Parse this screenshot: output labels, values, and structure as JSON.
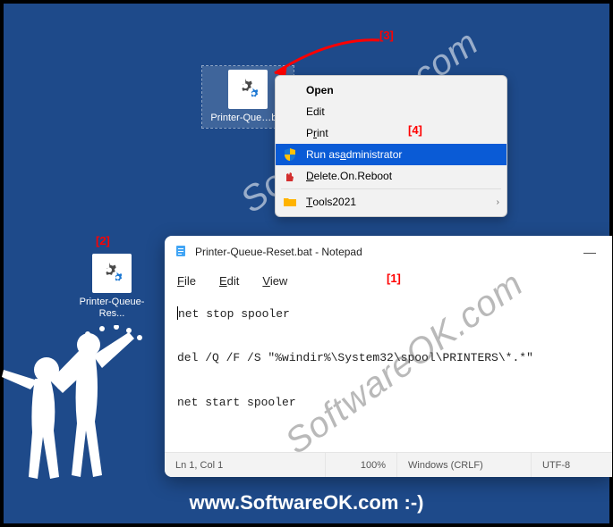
{
  "annotations": {
    "a1": "[1]",
    "a2": "[2]",
    "a3": "[3]",
    "a4": "[4]"
  },
  "desktop": {
    "icon1": {
      "label": "Printer-Que…bat"
    },
    "icon2": {
      "label": "Printer-Queue-Res..."
    }
  },
  "context_menu": {
    "open": "Open",
    "edit": "Edit",
    "print_pre": "P",
    "print_ul": "r",
    "print_post": "int",
    "runas_pre": "Run as ",
    "runas_ul": "a",
    "runas_post": "dministrator",
    "delonreboot_ul": "D",
    "delonreboot_post": "elete.On.Reboot",
    "tools_ul": "T",
    "tools_post": "ools2021",
    "chev": "›"
  },
  "notepad": {
    "title": "Printer-Queue-Reset.bat - Notepad",
    "menu": {
      "file": "File",
      "edit": "Edit",
      "view": "View"
    },
    "body_l1": "net stop spooler",
    "body_l2": "del /Q /F /S \"%windir%\\System32\\spool\\PRINTERS\\*.*\"",
    "body_l3": "net start spooler",
    "status": {
      "pos": "Ln 1, Col 1",
      "zoom": "100%",
      "enc": "Windows (CRLF)",
      "utf": "UTF-8"
    },
    "dash": "—"
  },
  "watermark": {
    "url": "www.SoftwareOK.com :-)",
    "diag": "SoftwareOK.com"
  }
}
